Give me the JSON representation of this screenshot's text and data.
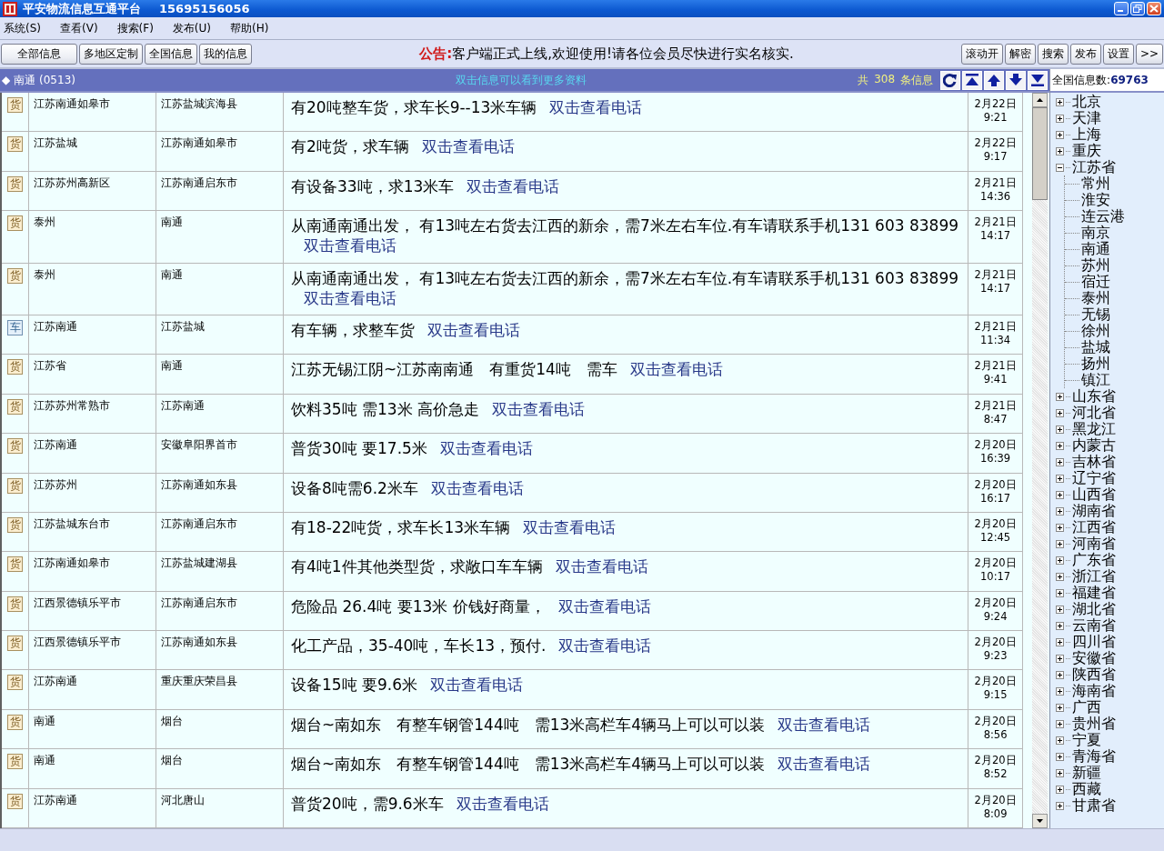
{
  "window": {
    "title": "平安物流信息互通平台",
    "phone": "15695156056"
  },
  "menu": [
    "系统(S)",
    "查看(V)",
    "搜索(F)",
    "发布(U)",
    "帮助(H)"
  ],
  "toolbar": {
    "left_buttons": [
      "全部信息",
      "多地区定制",
      "全国信息",
      "我的信息"
    ],
    "notice_label": "公告:",
    "notice": "客户端正式上线,欢迎使用!请各位会员尽快进行实名核实.",
    "right_buttons": [
      "滚动开",
      "解密",
      "搜索",
      "发布",
      "设置",
      ">>"
    ]
  },
  "list_header": {
    "marker": "◆",
    "region": "南通",
    "code": "(0513)",
    "hint": "双击信息可以看到更多资料",
    "total_prefix": "共",
    "total": "308",
    "total_suffix": "条信息"
  },
  "rows": [
    {
      "kind": "cargo",
      "mark": "货",
      "from": "江苏南通如皋市",
      "to": "江苏盐城滨海县",
      "content": "有20吨整车货，求车长9--13米车辆",
      "link": "双击查看电话",
      "date": "2月22日",
      "time": "9:21"
    },
    {
      "kind": "cargo",
      "mark": "货",
      "from": "江苏盐城",
      "to": "江苏南通如皋市",
      "content": "有2吨货，求车辆",
      "link": "双击查看电话",
      "date": "2月22日",
      "time": "9:17"
    },
    {
      "kind": "cargo",
      "mark": "货",
      "from": "江苏苏州高新区",
      "to": "江苏南通启东市",
      "content": "有设备33吨，求13米车",
      "link": "双击查看电话",
      "date": "2月21日",
      "time": "14:36"
    },
    {
      "kind": "cargo",
      "mark": "货",
      "from": "泰州",
      "to": "南通",
      "content": "从南通南通出发， 有13吨左右货去江西的新余，需7米左右车位.有车请联系手机131 603 83899",
      "link": "双击查看电话",
      "date": "2月21日",
      "time": "14:17"
    },
    {
      "kind": "cargo",
      "mark": "货",
      "from": "泰州",
      "to": "南通",
      "content": "从南通南通出发， 有13吨左右货去江西的新余，需7米左右车位.有车请联系手机131 603 83899",
      "link": "双击查看电话",
      "date": "2月21日",
      "time": "14:17"
    },
    {
      "kind": "vehicle",
      "mark": "车",
      "from": "江苏南通",
      "to": "江苏盐城",
      "content": "有车辆，求整车货",
      "link": "双击查看电话",
      "date": "2月21日",
      "time": "11:34"
    },
    {
      "kind": "cargo",
      "mark": "货",
      "from": "江苏省",
      "to": "南通",
      "content": "江苏无锡江阴~江苏南南通　有重货14吨　需车",
      "link": "双击查看电话",
      "date": "2月21日",
      "time": "9:41"
    },
    {
      "kind": "cargo",
      "mark": "货",
      "from": "江苏苏州常熟市",
      "to": "江苏南通",
      "content": "饮料35吨 需13米 高价急走",
      "link": "双击查看电话",
      "date": "2月21日",
      "time": "8:47"
    },
    {
      "kind": "cargo",
      "mark": "货",
      "from": "江苏南通",
      "to": "安徽阜阳界首市",
      "content": "普货30吨 要17.5米",
      "link": "双击查看电话",
      "date": "2月20日",
      "time": "16:39"
    },
    {
      "kind": "cargo",
      "mark": "货",
      "from": "江苏苏州",
      "to": "江苏南通如东县",
      "content": "设备8吨需6.2米车",
      "link": "双击查看电话",
      "date": "2月20日",
      "time": "16:17"
    },
    {
      "kind": "cargo",
      "mark": "货",
      "from": "江苏盐城东台市",
      "to": "江苏南通启东市",
      "content": "有18-22吨货，求车长13米车辆",
      "link": "双击查看电话",
      "date": "2月20日",
      "time": "12:45"
    },
    {
      "kind": "cargo",
      "mark": "货",
      "from": "江苏南通如皋市",
      "to": "江苏盐城建湖县",
      "content": "有4吨1件其他类型货，求敞口车车辆",
      "link": "双击查看电话",
      "date": "2月20日",
      "time": "10:17"
    },
    {
      "kind": "cargo",
      "mark": "货",
      "from": "江西景德镇乐平市",
      "to": "江苏南通启东市",
      "content": "危险品 26.4吨 要13米 价钱好商量，",
      "link": "双击查看电话",
      "date": "2月20日",
      "time": "9:24"
    },
    {
      "kind": "cargo",
      "mark": "货",
      "from": "江西景德镇乐平市",
      "to": "江苏南通如东县",
      "content": "化工产品，35-40吨，车长13，预付.",
      "link": "双击查看电话",
      "date": "2月20日",
      "time": "9:23"
    },
    {
      "kind": "cargo",
      "mark": "货",
      "from": "江苏南通",
      "to": "重庆重庆荣昌县",
      "content": "设备15吨 要9.6米",
      "link": "双击查看电话",
      "date": "2月20日",
      "time": "9:15"
    },
    {
      "kind": "cargo",
      "mark": "货",
      "from": "南通",
      "to": "烟台",
      "content": "烟台~南如东　有整车钢管144吨　需13米高栏车4辆马上可以可以装",
      "link": "双击查看电话",
      "date": "2月20日",
      "time": "8:56"
    },
    {
      "kind": "cargo",
      "mark": "货",
      "from": "南通",
      "to": "烟台",
      "content": "烟台~南如东　有整车钢管144吨　需13米高栏车4辆马上可以可以装",
      "link": "双击查看电话",
      "date": "2月20日",
      "time": "8:52"
    },
    {
      "kind": "cargo",
      "mark": "货",
      "from": "江苏南通",
      "to": "河北唐山",
      "content": "普货20吨，需9.6米车",
      "link": "双击查看电话",
      "date": "2月20日",
      "time": "8:09"
    }
  ],
  "region_tree": {
    "count_label": "全国信息数:",
    "count": "69763",
    "items": [
      {
        "label": "北京",
        "expanded": false
      },
      {
        "label": "天津",
        "expanded": false
      },
      {
        "label": "上海",
        "expanded": false
      },
      {
        "label": "重庆",
        "expanded": false
      },
      {
        "label": "江苏省",
        "expanded": true,
        "children": [
          {
            "label": "常州"
          },
          {
            "label": "淮安"
          },
          {
            "label": "连云港"
          },
          {
            "label": "南京"
          },
          {
            "label": "南通"
          },
          {
            "label": "苏州"
          },
          {
            "label": "宿迁"
          },
          {
            "label": "泰州"
          },
          {
            "label": "无锡"
          },
          {
            "label": "徐州"
          },
          {
            "label": "盐城"
          },
          {
            "label": "扬州"
          },
          {
            "label": "镇江"
          }
        ]
      },
      {
        "label": "山东省",
        "expanded": false
      },
      {
        "label": "河北省",
        "expanded": false
      },
      {
        "label": "黑龙江",
        "expanded": false
      },
      {
        "label": "内蒙古",
        "expanded": false
      },
      {
        "label": "吉林省",
        "expanded": false
      },
      {
        "label": "辽宁省",
        "expanded": false
      },
      {
        "label": "山西省",
        "expanded": false
      },
      {
        "label": "湖南省",
        "expanded": false
      },
      {
        "label": "江西省",
        "expanded": false
      },
      {
        "label": "河南省",
        "expanded": false
      },
      {
        "label": "广东省",
        "expanded": false
      },
      {
        "label": "浙江省",
        "expanded": false
      },
      {
        "label": "福建省",
        "expanded": false
      },
      {
        "label": "湖北省",
        "expanded": false
      },
      {
        "label": "云南省",
        "expanded": false
      },
      {
        "label": "四川省",
        "expanded": false
      },
      {
        "label": "安徽省",
        "expanded": false
      },
      {
        "label": "陕西省",
        "expanded": false
      },
      {
        "label": "海南省",
        "expanded": false
      },
      {
        "label": "广西",
        "expanded": false
      },
      {
        "label": "贵州省",
        "expanded": false
      },
      {
        "label": "宁夏",
        "expanded": false
      },
      {
        "label": "青海省",
        "expanded": false
      },
      {
        "label": "新疆",
        "expanded": false
      },
      {
        "label": "西藏",
        "expanded": false
      },
      {
        "label": "甘肃省",
        "expanded": false
      }
    ]
  }
}
